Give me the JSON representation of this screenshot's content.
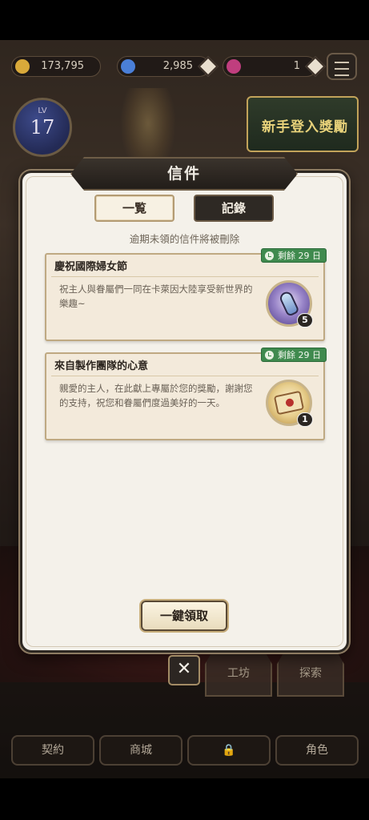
{
  "hud": {
    "gold": "173,795",
    "gems": "2,985",
    "hearts": "1",
    "level_label": "LV",
    "level": "17",
    "event_banner": "新手登入獎勵"
  },
  "bottom_nav": [
    "契約",
    "商城",
    "",
    "角色"
  ],
  "side_buttons": [
    "工坊",
    "探索"
  ],
  "dialog": {
    "title": "信件",
    "tabs": [
      "一覧",
      "記錄"
    ],
    "notice": "逾期未領的信件將被刪除",
    "mails": [
      {
        "title": "慶祝國際婦女節",
        "body": "祝主人與眷屬們一同在卡萊因大陸享受新世界的樂趣~",
        "tag": "剩餘 29 日",
        "item_icon": "potion-icon",
        "item_count": "5"
      },
      {
        "title": "來自製作團隊的心意",
        "body": "親愛的主人，在此獻上專屬於您的獎勵，謝謝您的支持，祝您和眷屬們度過美好的一天。",
        "tag": "剩餘 29 日",
        "item_icon": "scroll-icon",
        "item_count": "1"
      }
    ],
    "claim_all": "一鍵領取",
    "close_symbol": "✕"
  },
  "colors": {
    "dialog_bg": "#f4f1ea",
    "tag_green": "#3f8a4e",
    "dark_plate": "#2e2924"
  }
}
